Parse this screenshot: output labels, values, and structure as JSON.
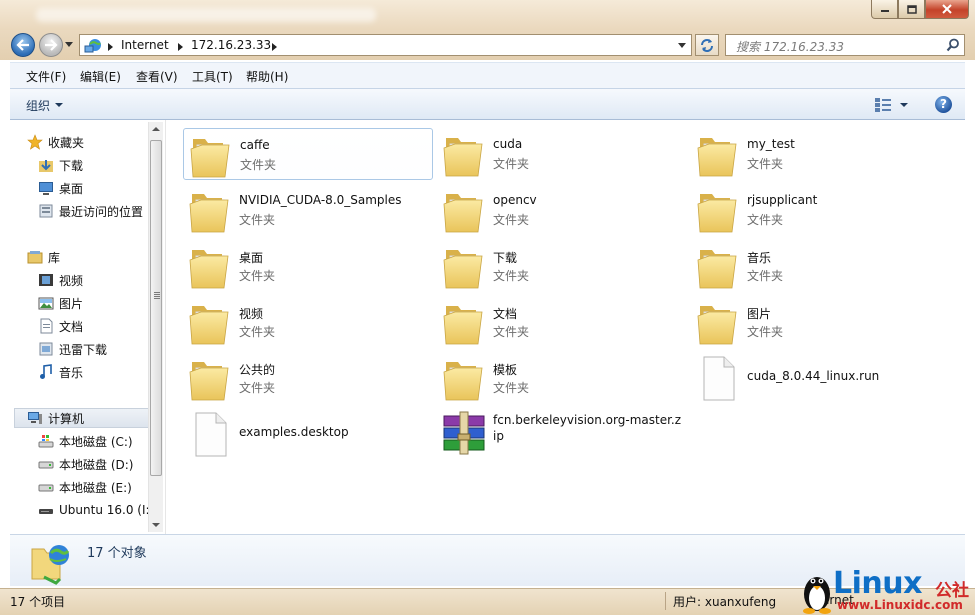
{
  "window": {
    "title": ""
  },
  "address": {
    "crumbs": [
      "Internet",
      "172.16.23.33"
    ],
    "search_placeholder": "搜索 172.16.23.33"
  },
  "menu": [
    "文件(F)",
    "编辑(E)",
    "查看(V)",
    "工具(T)",
    "帮助(H)"
  ],
  "toolbar": {
    "organize": "组织",
    "help": "?"
  },
  "nav": {
    "favorites": {
      "label": "收藏夹",
      "items": [
        "下载",
        "桌面",
        "最近访问的位置"
      ]
    },
    "libraries": {
      "label": "库",
      "items": [
        "视频",
        "图片",
        "文档",
        "迅雷下载",
        "音乐"
      ]
    },
    "computer": {
      "label": "计算机",
      "items": [
        "本地磁盘 (C:)",
        "本地磁盘 (D:)",
        "本地磁盘 (E:)",
        "Ubuntu 16.0 (I:)"
      ]
    }
  },
  "files": [
    {
      "name": "caffe",
      "type": "文件夹",
      "icon": "folder-icon"
    },
    {
      "name": "cuda",
      "type": "文件夹",
      "icon": "folder-icon"
    },
    {
      "name": "my_test",
      "type": "文件夹",
      "icon": "folder-icon"
    },
    {
      "name": "NVIDIA_CUDA-8.0_Samples",
      "type": "文件夹",
      "icon": "folder-icon"
    },
    {
      "name": "opencv",
      "type": "文件夹",
      "icon": "folder-icon"
    },
    {
      "name": "rjsupplicant",
      "type": "文件夹",
      "icon": "folder-icon"
    },
    {
      "name": "桌面",
      "type": "文件夹",
      "icon": "folder-icon"
    },
    {
      "name": "下载",
      "type": "文件夹",
      "icon": "folder-icon"
    },
    {
      "name": "音乐",
      "type": "文件夹",
      "icon": "folder-icon"
    },
    {
      "name": "视频",
      "type": "文件夹",
      "icon": "folder-icon"
    },
    {
      "name": "文档",
      "type": "文件夹",
      "icon": "folder-icon"
    },
    {
      "name": "图片",
      "type": "文件夹",
      "icon": "folder-icon"
    },
    {
      "name": "公共的",
      "type": "文件夹",
      "icon": "folder-icon"
    },
    {
      "name": "模板",
      "type": "文件夹",
      "icon": "folder-icon"
    },
    {
      "name": "cuda_8.0.44_linux.run",
      "type": "",
      "icon": "blank-file-icon"
    },
    {
      "name": "examples.desktop",
      "type": "",
      "icon": "blank-file-icon"
    },
    {
      "name": "fcn.berkeleyvision.org-master.zip",
      "type": "",
      "icon": "winrar-archive-icon"
    }
  ],
  "details": {
    "count": "17 个对象"
  },
  "status": {
    "count": "17 个项目",
    "user": "用户: xuanxufeng",
    "zone": "ernet"
  },
  "watermark": {
    "brand": "Linux",
    "cn": "公社",
    "url": "www.Linuxidc.com"
  },
  "colors": {
    "frame": "#ead8bd",
    "accent": "#1e395b",
    "selection_border": "#aac8e6",
    "watermark_blue": "#0f6fc6",
    "watermark_red": "#d12a2a"
  }
}
